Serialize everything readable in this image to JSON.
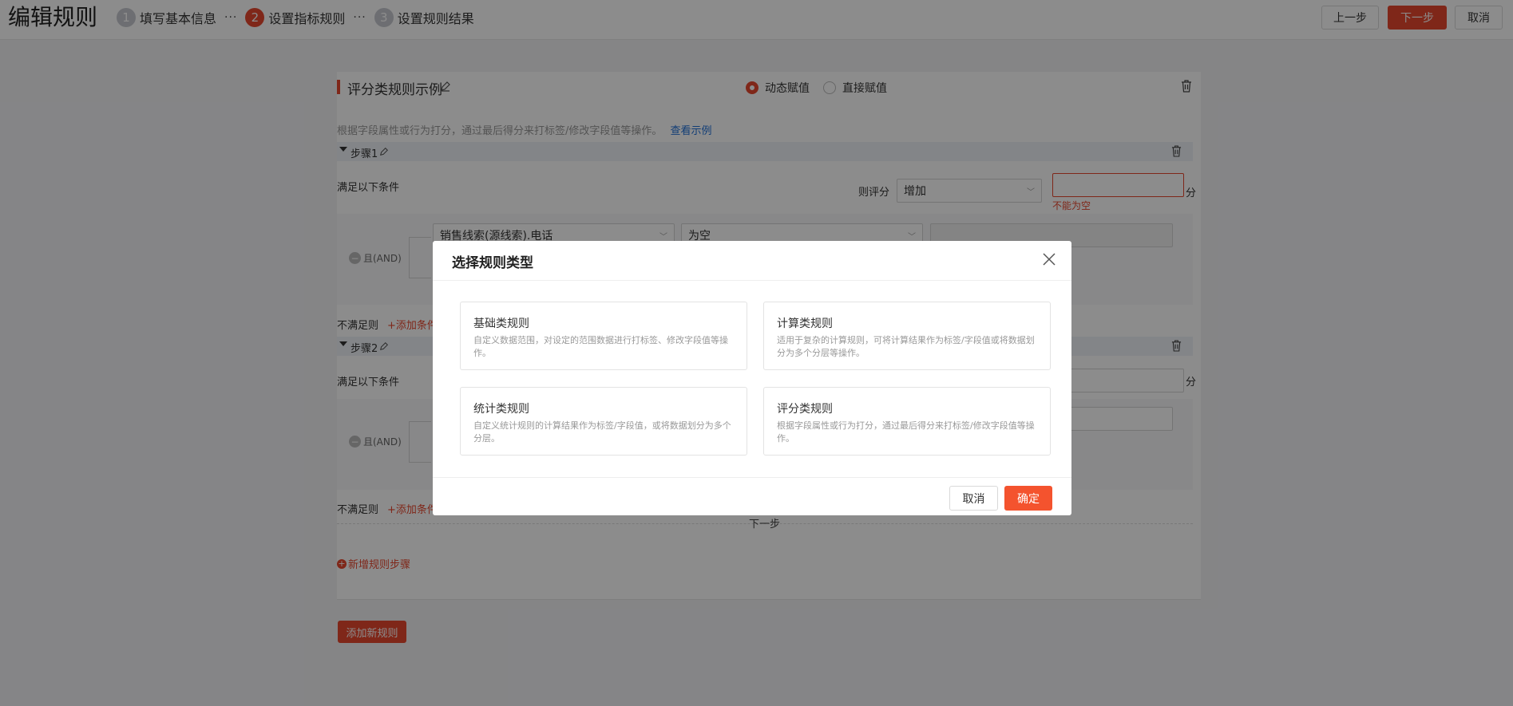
{
  "header": {
    "title": "编辑规则",
    "steps": [
      {
        "num": "1",
        "label": "填写基本信息"
      },
      {
        "num": "2",
        "label": "设置指标规则"
      },
      {
        "num": "3",
        "label": "设置规则结果"
      }
    ],
    "step_separator": "···",
    "prev_label": "上一步",
    "next_label": "下一步",
    "cancel_label": "取消"
  },
  "rule": {
    "name": "评分类规则示例",
    "mode_options": [
      "动态赋值",
      "直接赋值"
    ],
    "mode_selected": "动态赋值",
    "description": "根据字段属性或行为打分，通过最后得分来打标签/修改字段值等操作。",
    "example_link": "查看示例",
    "steps": [
      {
        "title": "步骤1",
        "condition_label": "满足以下条件",
        "score_label": "则评分",
        "score_op": "增加",
        "score_value": "",
        "score_unit": "分",
        "error": "不能为空",
        "logic": "且(AND)",
        "field": "销售线索(源线索).电话",
        "operator": "为空",
        "else_label": "不满足则",
        "add_condition": "+添加条件"
      },
      {
        "title": "步骤2",
        "condition_label": "满足以下条件",
        "score_unit": "分",
        "logic": "且(AND)",
        "else_label": "不满足则",
        "add_condition": "+添加条件",
        "next_label": "下一步"
      }
    ],
    "add_step": "新增规则步骤",
    "add_rule": "添加新规则"
  },
  "modal": {
    "title": "选择规则类型",
    "options": [
      {
        "title": "基础类规则",
        "desc": "自定义数据范围，对设定的范围数据进行打标签、修改字段值等操作。"
      },
      {
        "title": "计算类规则",
        "desc": "适用于复杂的计算规则，可将计算结果作为标签/字段值或将数据划分为多个分层等操作。"
      },
      {
        "title": "统计类规则",
        "desc": "自定义统计规则的计算结果作为标签/字段值，或将数据划分为多个分层。"
      },
      {
        "title": "评分类规则",
        "desc": "根据字段属性或行为打分，通过最后得分来打标签/修改字段值等操作。"
      }
    ],
    "cancel_label": "取消",
    "confirm_label": "确定"
  },
  "colors": {
    "accent": "#e8472f",
    "link": "#1f6fd8"
  }
}
